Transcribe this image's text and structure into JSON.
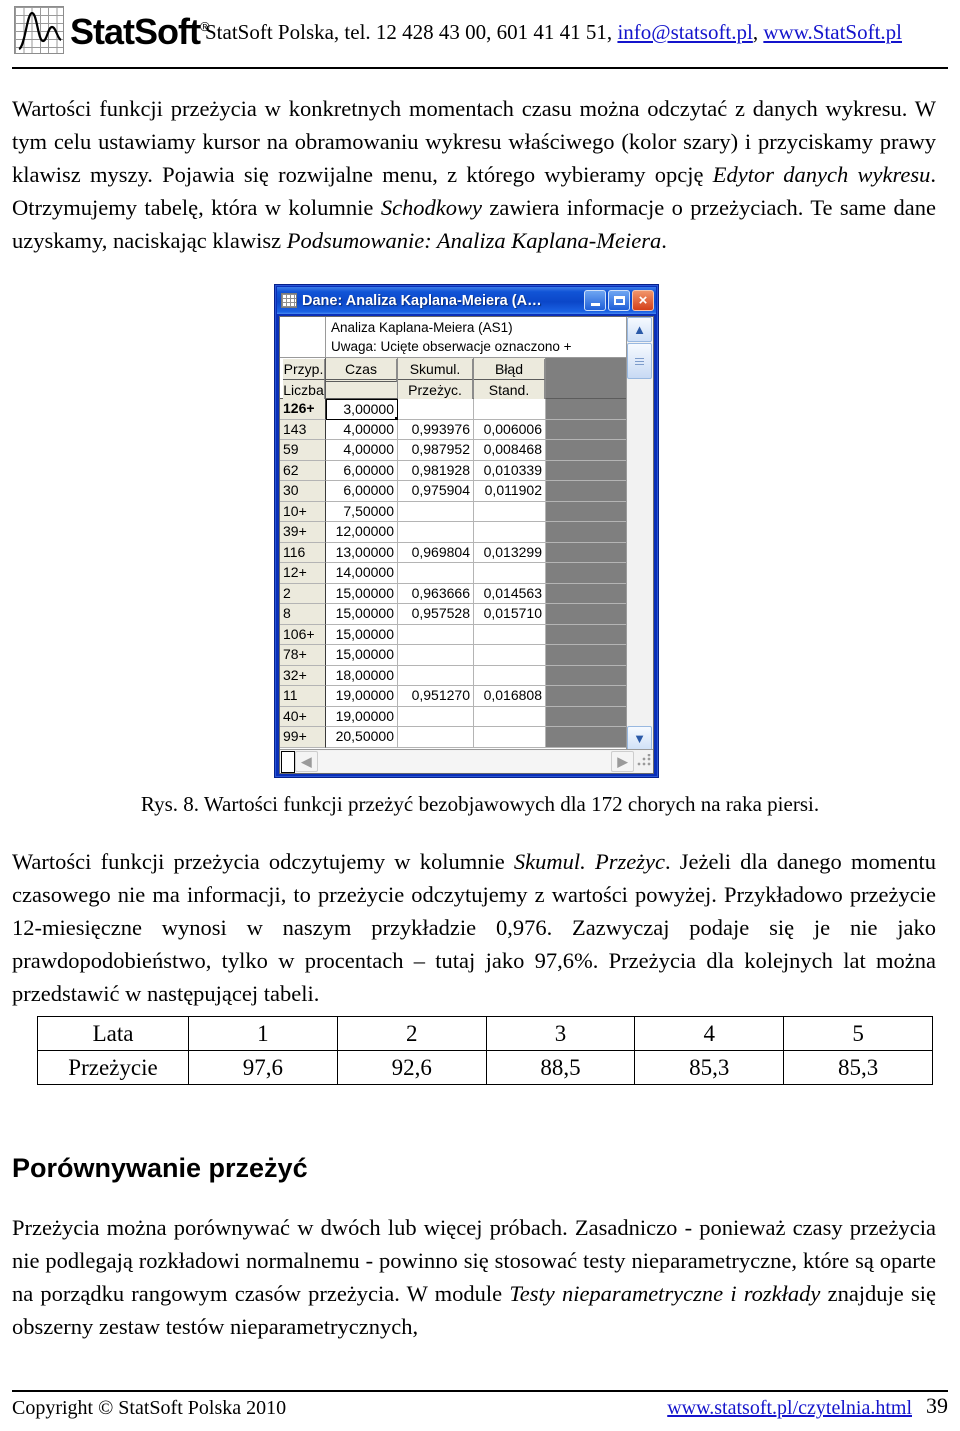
{
  "header": {
    "logo_text": "StatSoft",
    "logo_reg": "®",
    "contact_prefix": "StatSoft Polska, tel. 12 428 43 00, 601 41 41 51, ",
    "email": "info@statsoft.pl",
    "comma": ", ",
    "website": "www.StatSoft.pl"
  },
  "paragraphs": {
    "p1_a": "Wartości funkcji przeżycia w konkretnych momentach czasu można odczytać z danych wykresu. W tym celu ustawiamy kursor na obramowaniu wykresu właściwego (kolor szary) i przyciskamy prawy klawisz myszy. Pojawia się rozwijalne menu, z którego wybieramy opcję ",
    "p1_i1": "Edytor danych wykresu",
    "p1_b": ". Otrzymujemy tabelę, która w kolumnie ",
    "p1_i2": "Schodkowy",
    "p1_c": " zawiera informacje o przeżyciach. Te same dane uzyskamy, naciskając klawisz ",
    "p1_i3": "Podsumowanie: Analiza Kaplana-Meiera",
    "p1_d": ".",
    "p2_a": "Wartości funkcji przeżycia odczytujemy w kolumnie ",
    "p2_i1": "Skumul. Przeżyc",
    "p2_b": ". Jeżeli dla danego momentu czasowego nie ma informacji, to przeżycie odczytujemy z wartości powyżej. Przykładowo przeżycie 12-miesięczne wynosi w naszym przykładzie 0,976. Zazwyczaj podaje się je nie jako prawdopodobieństwo, tylko w procentach – tutaj jako 97,6%. Przeżycia dla kolejnych lat można przedstawić w następującej tabeli.",
    "p3_a": "Przeżycia można porównywać w dwóch lub więcej próbach. Zasadniczo - ponieważ czasy przeżycia nie podlegają rozkładowi normalnemu - powinno się stosować testy nieparametryczne, które są oparte na porządku rangowym czasów przeżycia. W module ",
    "p3_i1": "Testy nieparametryczne i rozkłady",
    "p3_b": " znajduje się obszerny zestaw testów nieparametrycznych,"
  },
  "figure": {
    "caption": "Rys. 8. Wartości funkcji przeżyć bezobjawowych dla 172 chorych na raka piersi.",
    "window": {
      "title": "Dane: Analiza Kaplana-Meiera (A…",
      "minimize_label": "",
      "maximize_label": "",
      "close_label": "×",
      "sheet_title_line1": "Analiza Kaplana-Meiera (AS1)",
      "sheet_title_line2": "Uwaga: Ucięte obserwacje oznaczono +",
      "columns": [
        {
          "line1": "Przyp.",
          "line2": "Liczba"
        },
        {
          "line1": "Czas",
          "line2": ""
        },
        {
          "line1": "Skumul.",
          "line2": "Przeżyc."
        },
        {
          "line1": "Błąd",
          "line2": "Stand."
        },
        {
          "line1": "",
          "line2": ""
        }
      ],
      "rows": [
        {
          "label": "126+",
          "czas": "3,00000",
          "skumul": "",
          "blad": ""
        },
        {
          "label": "143",
          "czas": "4,00000",
          "skumul": "0,993976",
          "blad": "0,006006"
        },
        {
          "label": "59",
          "czas": "4,00000",
          "skumul": "0,987952",
          "blad": "0,008468"
        },
        {
          "label": "62",
          "czas": "6,00000",
          "skumul": "0,981928",
          "blad": "0,010339"
        },
        {
          "label": "30",
          "czas": "6,00000",
          "skumul": "0,975904",
          "blad": "0,011902"
        },
        {
          "label": "10+",
          "czas": "7,50000",
          "skumul": "",
          "blad": ""
        },
        {
          "label": "39+",
          "czas": "12,00000",
          "skumul": "",
          "blad": ""
        },
        {
          "label": "116",
          "czas": "13,00000",
          "skumul": "0,969804",
          "blad": "0,013299"
        },
        {
          "label": "12+",
          "czas": "14,00000",
          "skumul": "",
          "blad": ""
        },
        {
          "label": "2",
          "czas": "15,00000",
          "skumul": "0,963666",
          "blad": "0,014563"
        },
        {
          "label": "8",
          "czas": "15,00000",
          "skumul": "0,957528",
          "blad": "0,015710"
        },
        {
          "label": "106+",
          "czas": "15,00000",
          "skumul": "",
          "blad": ""
        },
        {
          "label": "78+",
          "czas": "15,00000",
          "skumul": "",
          "blad": ""
        },
        {
          "label": "32+",
          "czas": "18,00000",
          "skumul": "",
          "blad": ""
        },
        {
          "label": "11",
          "czas": "19,00000",
          "skumul": "0,951270",
          "blad": "0,016808"
        },
        {
          "label": "40+",
          "czas": "19,00000",
          "skumul": "",
          "blad": ""
        },
        {
          "label": "99+",
          "czas": "20,50000",
          "skumul": "",
          "blad": ""
        }
      ]
    }
  },
  "lata_table": {
    "row_labels": [
      "Lata",
      "Przeżycie"
    ],
    "years": [
      "1",
      "2",
      "3",
      "4",
      "5"
    ],
    "survival": [
      "97,6",
      "92,6",
      "88,5",
      "85,3",
      "85,3"
    ]
  },
  "section": {
    "heading": "Porównywanie przeżyć"
  },
  "footer": {
    "copyright": "Copyright © StatSoft Polska 2010",
    "link": "www.statsoft.pl/czytelnia.html",
    "page_number": "39"
  }
}
